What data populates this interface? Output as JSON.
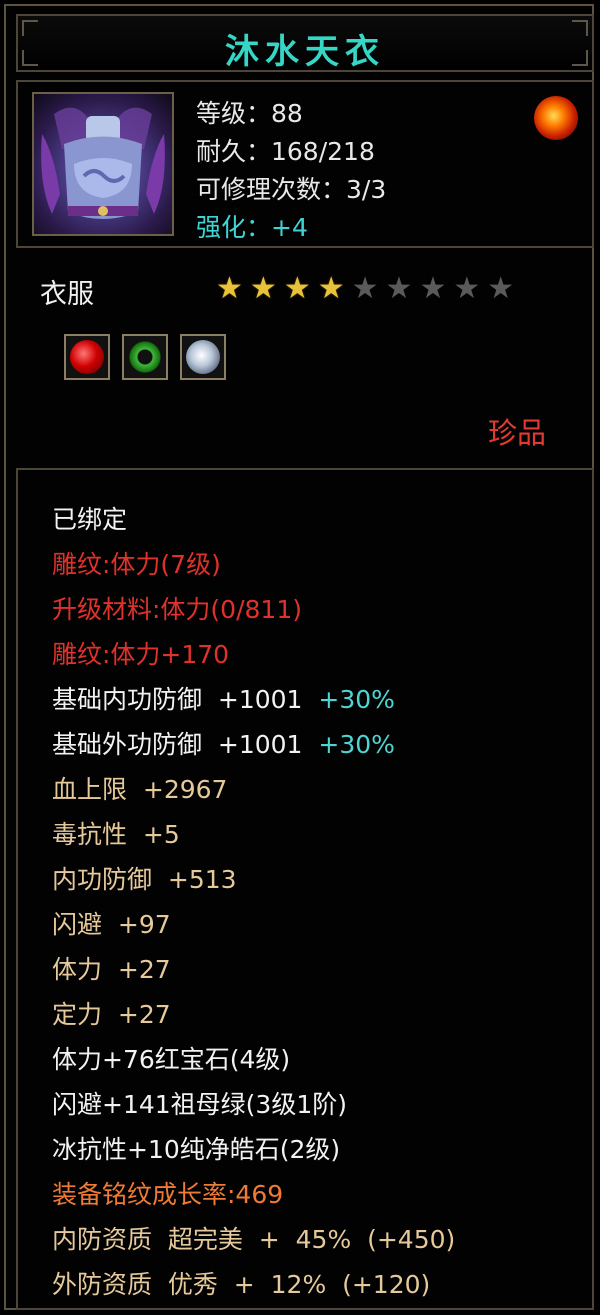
{
  "item": {
    "name": "沐水天衣",
    "level_line": "等级：88",
    "durability_line": "耐久：168/218",
    "repair_line": "可修理次数：3/3",
    "enhance_line": "强化：+4",
    "category": "衣服",
    "stars": {
      "filled": 4,
      "total": 9
    },
    "gems": [
      "red-gem-icon",
      "green-jade-ring-icon",
      "white-diamond-icon"
    ],
    "rarity": "珍品"
  },
  "stats": {
    "bound": "已绑定",
    "engrave1": "雕纹:体力(7级)",
    "upgrade_material": "升级材料:体力(0/811)",
    "engrave2": "雕纹:体力+170",
    "inner_def_base": "基础内功防御  +1001",
    "inner_def_bonus": "+30%",
    "outer_def_base": "基础外功防御  +1001",
    "outer_def_bonus": "+30%",
    "hp_max": "血上限  +2967",
    "poison_res": "毒抗性  +5",
    "inner_def": "内功防御  +513",
    "dodge": "闪避  +97",
    "stamina": "体力  +27",
    "focus": "定力  +27",
    "gem_ruby": "体力+76红宝石(4级)",
    "gem_emerald": "闪避+141祖母绿(3级1阶)",
    "gem_diamond": "冰抗性+10纯净皓石(2级)",
    "growth_rate": "装备铭纹成长率:469",
    "inner_quality": "内防资质  超完美  +  45%  (+450)",
    "outer_quality": "外防资质  优秀  +  12%  (+120)"
  },
  "colors": {
    "title": "#35d6c6",
    "red": "#e0312a",
    "tan": "#e6c99a",
    "orange": "#ee7a36",
    "cyan": "#4fd4d4",
    "star_on": "#e8c23a",
    "star_off": "#5a5a5a"
  }
}
